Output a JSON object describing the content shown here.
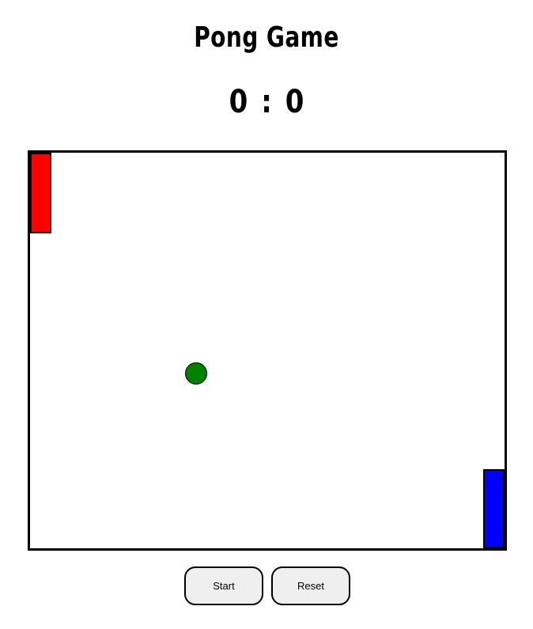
{
  "title": "Pong Game",
  "score": {
    "left": "0",
    "separator": ":",
    "right": "0"
  },
  "game": {
    "board_border_color": "#000000",
    "left_paddle_color": "#ff0000",
    "right_paddle_color": "#0000ff",
    "ball_color": "#008000"
  },
  "controls": {
    "start_label": "Start",
    "reset_label": "Reset"
  }
}
